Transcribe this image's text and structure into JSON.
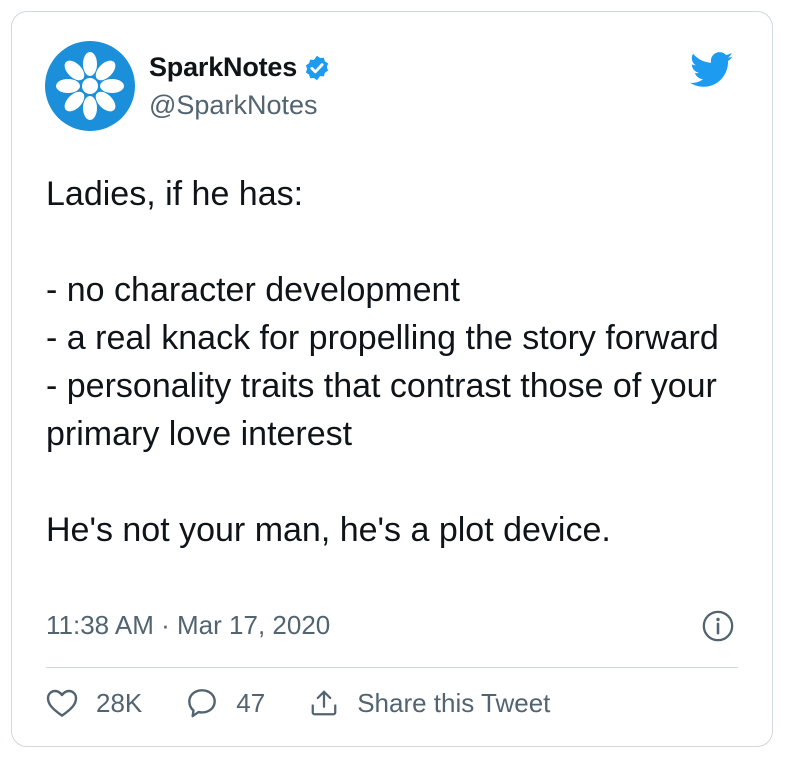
{
  "author": {
    "name": "SparkNotes",
    "handle": "@SparkNotes",
    "verified": true,
    "avatar_color": "#1b8fd9"
  },
  "tweet": {
    "text": "Ladies, if he has:\n\n- no character development\n- a real knack for propelling the story forward\n- personality traits that contrast those of your primary love interest\n\nHe's not your man, he's a plot device.",
    "timestamp": "11:38 AM · Mar 17, 2020"
  },
  "actions": {
    "likes": "28K",
    "replies": "47",
    "share_label": "Share this Tweet"
  },
  "icons": {
    "brand": "twitter-bird-icon",
    "info": "info-icon",
    "like": "heart-icon",
    "reply": "speech-bubble-icon",
    "share": "share-icon",
    "verified": "verified-badge-icon"
  },
  "colors": {
    "accent": "#1d9bf0",
    "text": "#0f1419",
    "secondary": "#536471",
    "border": "#cfd9de"
  }
}
